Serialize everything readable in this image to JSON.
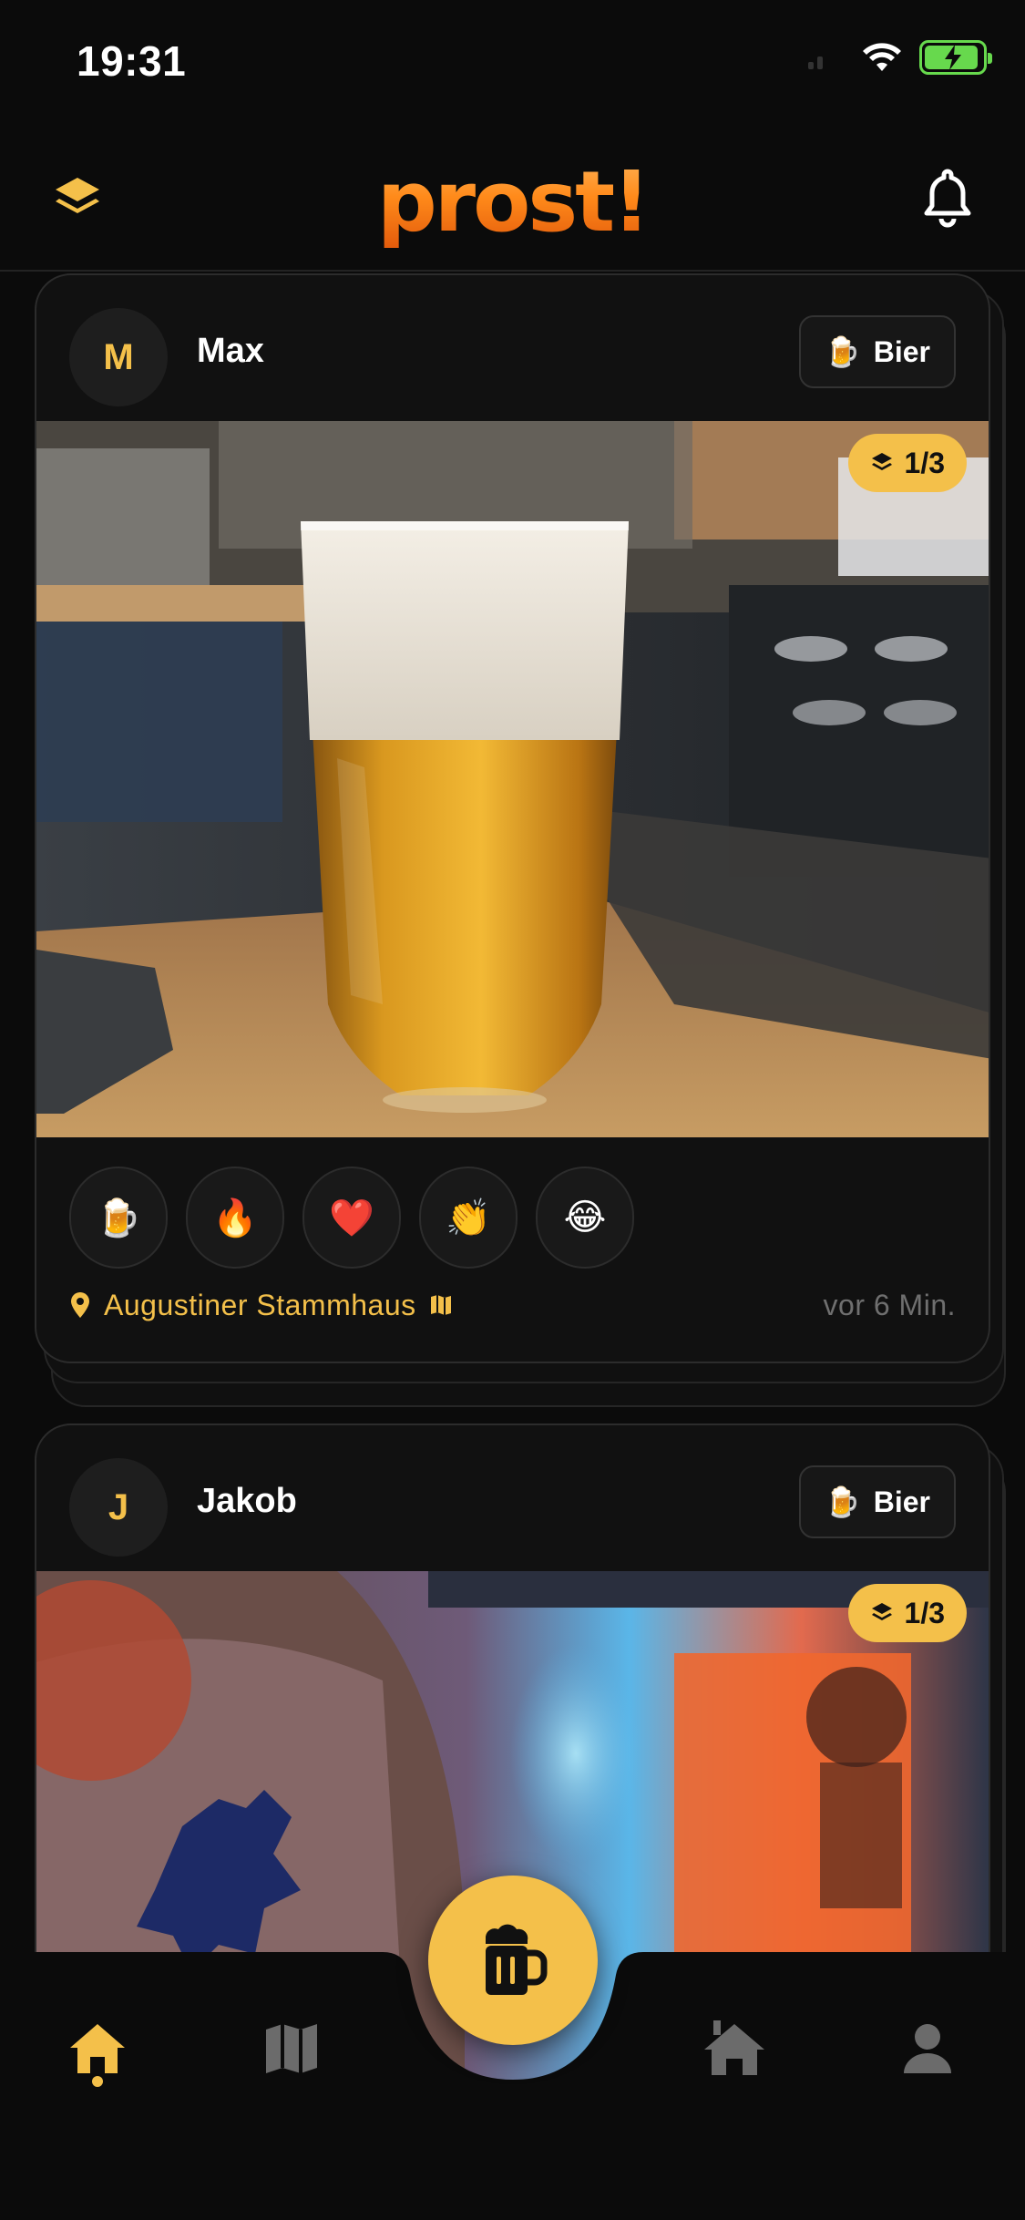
{
  "status_bar": {
    "time": "19:31"
  },
  "header": {
    "logo_text": "prost!"
  },
  "posts": [
    {
      "avatar_initial": "M",
      "user": "Max",
      "drink_label": "Bier",
      "photo_counter": "1/3",
      "reactions": [
        "🍺",
        "🔥",
        "❤️",
        "👏",
        "😂"
      ],
      "location": "Augustiner Stammhaus",
      "time_ago": "vor 6 Min."
    },
    {
      "avatar_initial": "J",
      "user": "Jakob",
      "drink_label": "Bier",
      "photo_counter": "1/3"
    }
  ],
  "bottom_nav": {
    "items": [
      "home-icon",
      "map-icon",
      "beer-mug-icon",
      "bar-icon",
      "profile-icon"
    ],
    "active": "home-icon"
  },
  "colors": {
    "accent": "#f4c04a",
    "background": "#0b0b0b",
    "card": "#111111",
    "muted": "#6f6f6f"
  }
}
